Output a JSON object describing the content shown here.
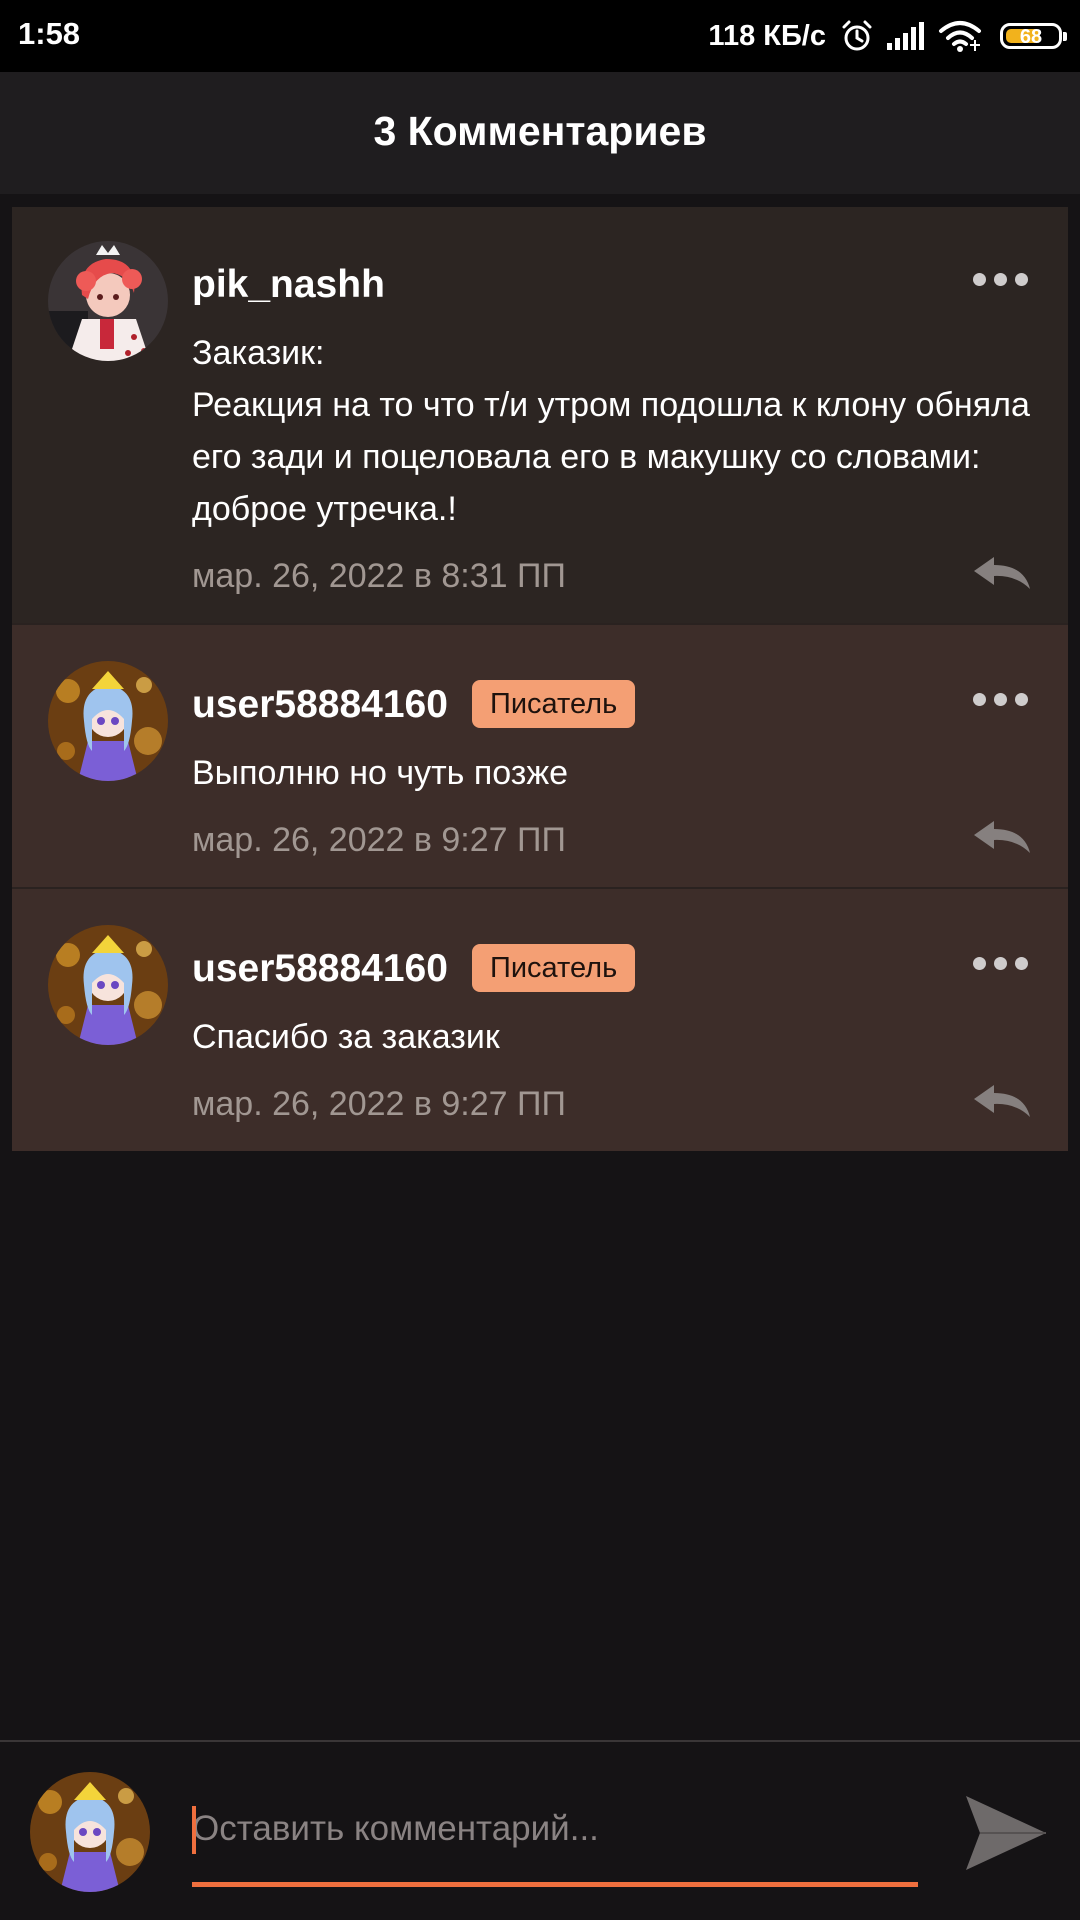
{
  "status_bar": {
    "time": "1:58",
    "network_speed": "118 КБ/с",
    "battery_level": "68",
    "battery_fraction": 0.68,
    "icons": [
      "alarm-icon",
      "signal-icon",
      "wifi-icon",
      "battery-icon"
    ]
  },
  "header": {
    "title": "3 Комментариев"
  },
  "colors": {
    "accent": "#ef6f3e",
    "badge": "#f49f74",
    "card_first": "#2c2522",
    "card_rest": "#3d2d29"
  },
  "comments": [
    {
      "author": "pik_nashh",
      "badge": "",
      "text": "Заказик:\nРеакция на то что т/и утром подошла к клону обняла его зади и поцеловала его в макушку со словами: доброе утречка.!",
      "date": "мар. 26, 2022 в 8:31 ПП",
      "avatar_icon": "avatar-red-hair-icon"
    },
    {
      "author": "user58884160",
      "badge": "Писатель",
      "text": "Выполню но чуть позже",
      "date": "мар. 26, 2022 в 9:27 ПП",
      "avatar_icon": "avatar-blue-hair-icon"
    },
    {
      "author": "user58884160",
      "badge": "Писатель",
      "text": "Спасибо за заказик",
      "date": "мар. 26, 2022 в 9:27 ПП",
      "avatar_icon": "avatar-blue-hair-icon"
    }
  ],
  "composer": {
    "placeholder": "Оставить комментарий...",
    "value": "",
    "send_icon": "send-icon",
    "avatar_icon": "avatar-blue-hair-icon"
  }
}
